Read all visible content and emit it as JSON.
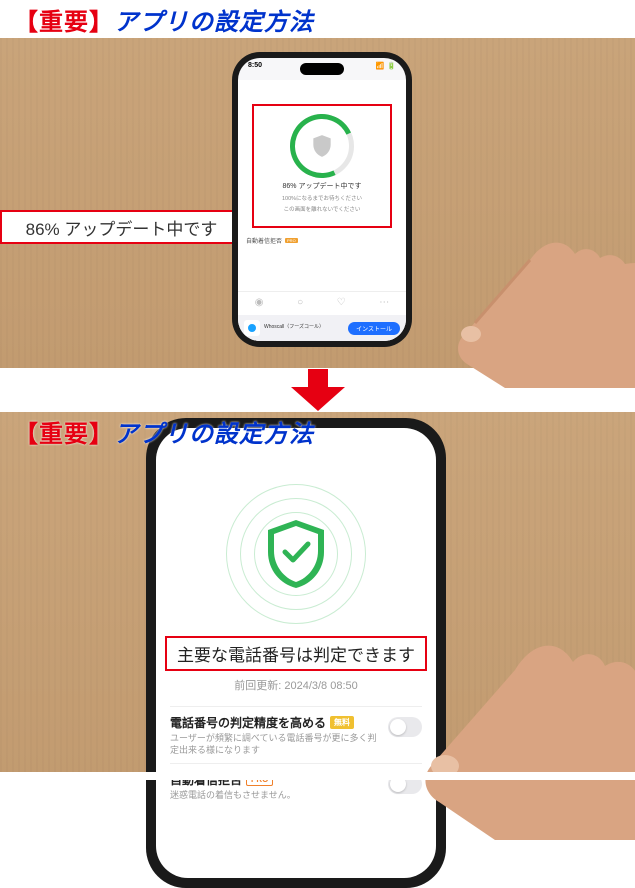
{
  "titles": {
    "important": "【重要】",
    "main": "アプリの設定方法"
  },
  "panel1": {
    "callout": "86% アップデート中です",
    "status_time": "8:50",
    "ring_text_main": "86% アップデート中です",
    "ring_text_sub1": "100%になるまでお待ちください",
    "ring_text_sub2": "この画面を離れないでください",
    "auto_call_label": "自動着信拒否",
    "pro_tag": "PRO",
    "install_app_name": "Whoscall（フーズコール）",
    "install_btn": "インストール"
  },
  "panel2": {
    "main_msg": "主要な電話番号は判定できます",
    "last_update_label": "前回更新:",
    "last_update_time": "2024/3/8 08:50",
    "row1_title": "電話番号の判定精度を高める",
    "row1_tag": "無料",
    "row1_sub": "ユーザーが頻繁に調べている電話番号が更に多く判定出来る様になります",
    "row2_title": "自動着信拒否",
    "row2_tag": "PRO",
    "row2_sub": "迷惑電話の着信もさせません。"
  }
}
